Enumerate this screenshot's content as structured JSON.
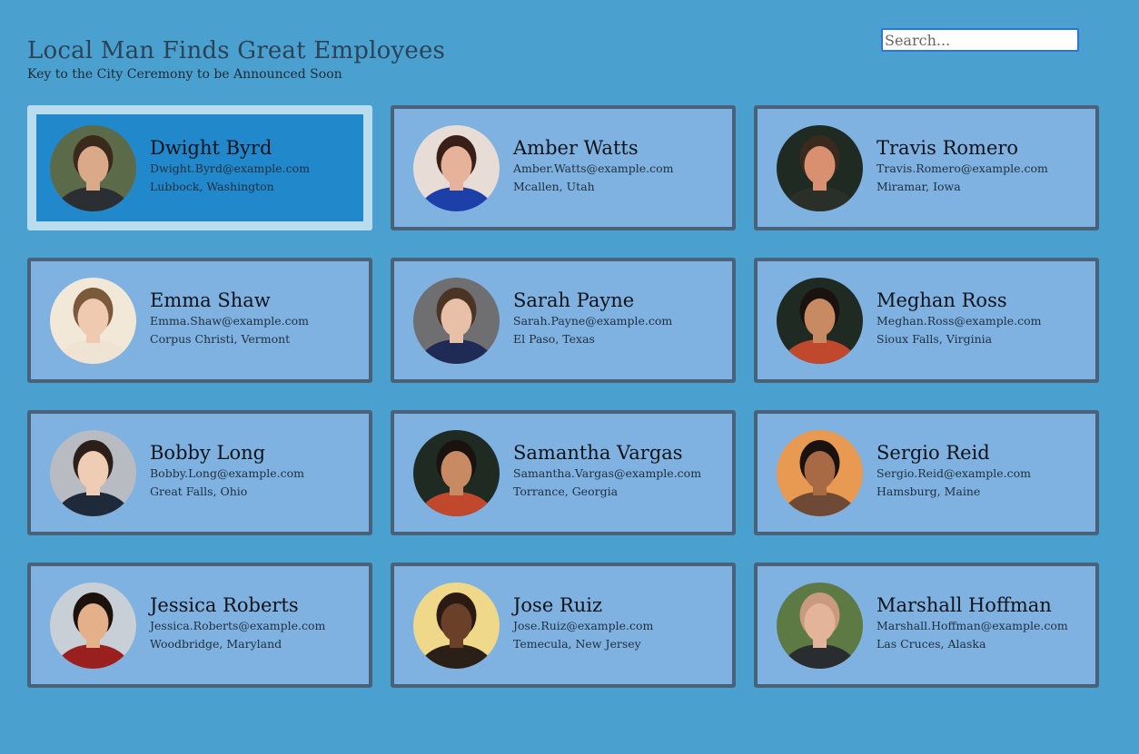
{
  "header": {
    "title": "Local Man Finds Great Employees",
    "subtitle": "Key to the City Ceremony to be Announced Soon"
  },
  "search": {
    "placeholder": "Search..."
  },
  "employees": [
    {
      "name": "Dwight Byrd",
      "email": "Dwight.Byrd@example.com",
      "location": "Lubbock, Washington",
      "selected": true,
      "avatar": {
        "bg": "#5b6b4a",
        "skin": "#d9a98a",
        "hair": "#3b2a1c",
        "shirt": "#2b2e33"
      }
    },
    {
      "name": "Amber Watts",
      "email": "Amber.Watts@example.com",
      "location": "Mcallen, Utah",
      "selected": false,
      "avatar": {
        "bg": "#e7ddd6",
        "skin": "#e6b39a",
        "hair": "#3a1f18",
        "shirt": "#1c3fa8"
      }
    },
    {
      "name": "Travis Romero",
      "email": "Travis.Romero@example.com",
      "location": "Miramar, Iowa",
      "selected": false,
      "avatar": {
        "bg": "#1f2a22",
        "skin": "#d99070",
        "hair": "#3a2a1e",
        "shirt": "#2a2f2a"
      }
    },
    {
      "name": "Emma Shaw",
      "email": "Emma.Shaw@example.com",
      "location": "Corpus Christi, Vermont",
      "selected": false,
      "avatar": {
        "bg": "#f1e8d8",
        "skin": "#efc9b0",
        "hair": "#7a5a3a",
        "shirt": "#efe3d4"
      }
    },
    {
      "name": "Sarah Payne",
      "email": "Sarah.Payne@example.com",
      "location": "El Paso, Texas",
      "selected": false,
      "avatar": {
        "bg": "#6f6f72",
        "skin": "#e8c0a8",
        "hair": "#4a3426",
        "shirt": "#1f2a55"
      }
    },
    {
      "name": "Meghan Ross",
      "email": "Meghan.Ross@example.com",
      "location": "Sioux Falls, Virginia",
      "selected": false,
      "avatar": {
        "bg": "#1e2a22",
        "skin": "#c78a62",
        "hair": "#1a120e",
        "shirt": "#c0482c"
      }
    },
    {
      "name": "Bobby Long",
      "email": "Bobby.Long@example.com",
      "location": "Great Falls, Ohio",
      "selected": false,
      "avatar": {
        "bg": "#b8bcc2",
        "skin": "#efccb4",
        "hair": "#2c1e18",
        "shirt": "#1e2a3a"
      }
    },
    {
      "name": "Samantha Vargas",
      "email": "Samantha.Vargas@example.com",
      "location": "Torrance, Georgia",
      "selected": false,
      "avatar": {
        "bg": "#1e2a22",
        "skin": "#c78a62",
        "hair": "#1a120e",
        "shirt": "#c0482c"
      }
    },
    {
      "name": "Sergio Reid",
      "email": "Sergio.Reid@example.com",
      "location": "Hamsburg, Maine",
      "selected": false,
      "avatar": {
        "bg": "#e99a52",
        "skin": "#a86a44",
        "hair": "#1a120e",
        "shirt": "#6e4a36"
      }
    },
    {
      "name": "Jessica Roberts",
      "email": "Jessica.Roberts@example.com",
      "location": "Woodbridge, Maryland",
      "selected": false,
      "avatar": {
        "bg": "#c9cfd6",
        "skin": "#e3b08a",
        "hair": "#1c120d",
        "shirt": "#9a1f1f"
      }
    },
    {
      "name": "Jose Ruiz",
      "email": "Jose.Ruiz@example.com",
      "location": "Temecula, New Jersey",
      "selected": false,
      "avatar": {
        "bg": "#f0d88a",
        "skin": "#6a4028",
        "hair": "#2a1a12",
        "shirt": "#2a2018"
      }
    },
    {
      "name": "Marshall Hoffman",
      "email": "Marshall.Hoffman@example.com",
      "location": "Las Cruces, Alaska",
      "selected": false,
      "avatar": {
        "bg": "#5e7a44",
        "skin": "#e3b49a",
        "hair": "#c99a80",
        "shirt": "#2a2d30"
      }
    }
  ]
}
